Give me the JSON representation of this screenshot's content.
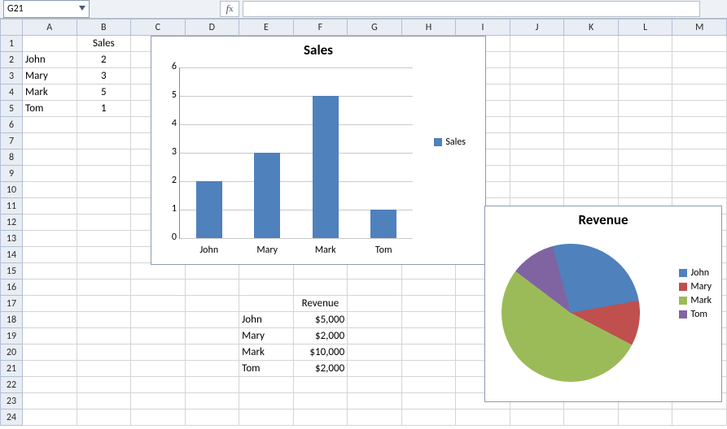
{
  "cell_ref": "G21",
  "columns": [
    "A",
    "B",
    "C",
    "D",
    "E",
    "F",
    "G",
    "H",
    "I",
    "J",
    "K",
    "L",
    "M"
  ],
  "rows_count": 24,
  "data_header": {
    "sales": "Sales",
    "revenue": "Revenue"
  },
  "sales_table": {
    "names": [
      "John",
      "Mary",
      "Mark",
      "Tom"
    ],
    "values": [
      2,
      3,
      5,
      1
    ]
  },
  "revenue_table": {
    "names": [
      "John",
      "Mary",
      "Mark",
      "Tom"
    ],
    "values_text": [
      "$5,000",
      "$2,000",
      "$10,000",
      "$2,000"
    ]
  },
  "chart_data": [
    {
      "type": "bar",
      "title": "Sales",
      "categories": [
        "John",
        "Mary",
        "Mark",
        "Tom"
      ],
      "series": [
        {
          "name": "Sales",
          "values": [
            2,
            3,
            5,
            1
          ]
        }
      ],
      "ylim": [
        0,
        6
      ],
      "yticks": [
        0,
        1,
        2,
        3,
        4,
        5,
        6
      ]
    },
    {
      "type": "pie",
      "title": "Revenue",
      "categories": [
        "John",
        "Mary",
        "Mark",
        "Tom"
      ],
      "values": [
        5000,
        2000,
        10000,
        2000
      ],
      "colors": [
        "#4f81bd",
        "#c0504d",
        "#9bbb59",
        "#8064a2"
      ]
    }
  ]
}
